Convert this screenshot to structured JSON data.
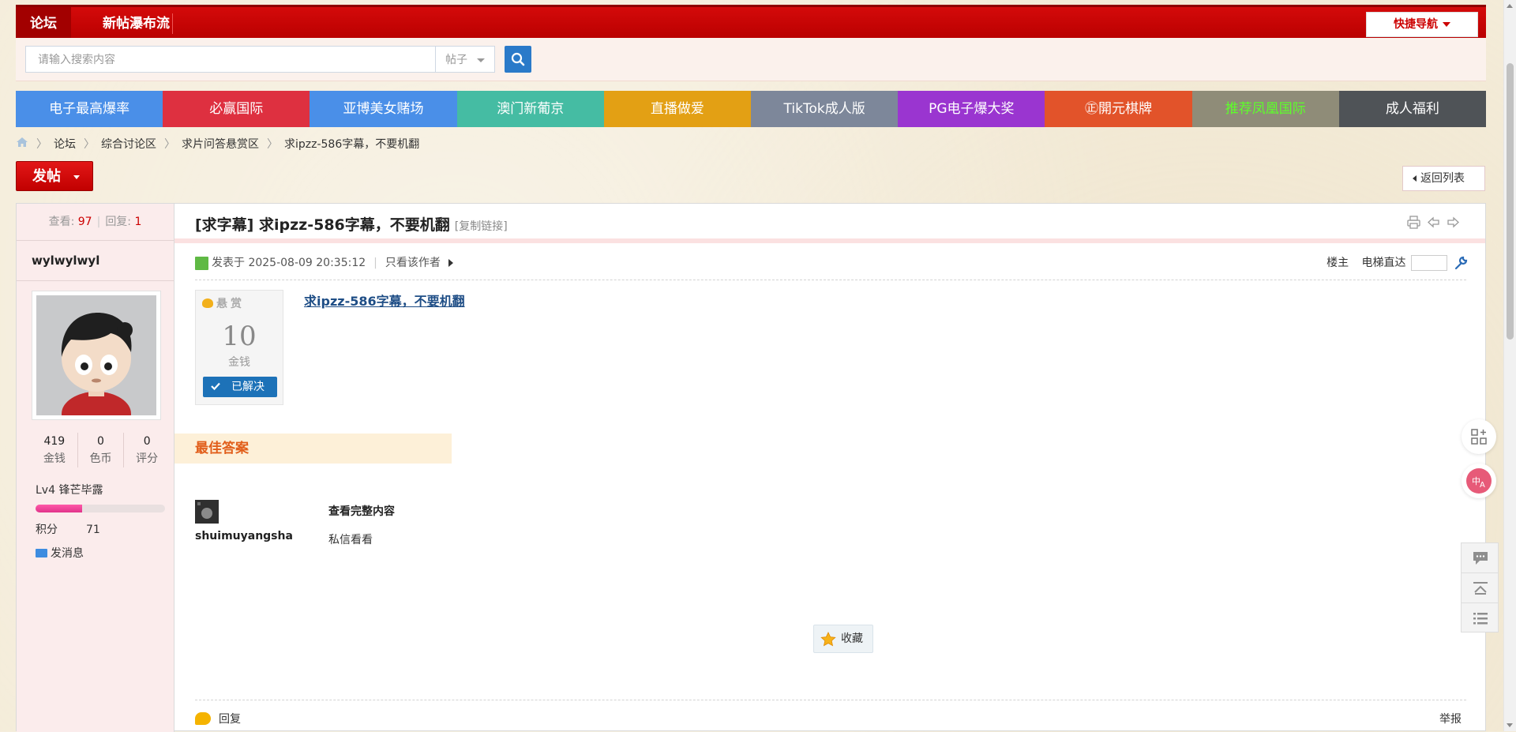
{
  "topnav": {
    "items": [
      {
        "label": "论坛"
      },
      {
        "label": "新帖瀑布流"
      }
    ],
    "quick_nav": "快捷导航"
  },
  "search": {
    "placeholder": "请输入搜索内容",
    "type": "帖子"
  },
  "ads": [
    {
      "label": "电子最高爆率",
      "bg": "#4a8fe8",
      "color": "#ffffff"
    },
    {
      "label": "必赢国际",
      "bg": "#de3040",
      "color": "#ffffff"
    },
    {
      "label": "亚博美女赌场",
      "bg": "#4a8fe8",
      "color": "#ffffff"
    },
    {
      "label": "澳门新葡京",
      "bg": "#45bca3",
      "color": "#ffffff"
    },
    {
      "label": "直播做爱",
      "bg": "#e3a014",
      "color": "#ffffff"
    },
    {
      "label": "TikTok成人版",
      "bg": "#7d879a",
      "color": "#ffffff"
    },
    {
      "label": "PG电子爆大奖",
      "bg": "#9a35d0",
      "color": "#ffffff"
    },
    {
      "label": "㊣開元棋牌",
      "bg": "#e2532a",
      "color": "#ffffff"
    },
    {
      "label": "推荐凤凰国际",
      "bg": "#8f8c78",
      "color": "#5dff2a"
    },
    {
      "label": "成人福利",
      "bg": "#4f5357",
      "color": "#ffffff"
    }
  ],
  "breadcrumb": [
    "论坛",
    "综合讨论区",
    "求片问答悬赏区",
    "求ipzz-586字幕，不要机翻"
  ],
  "buttons": {
    "post": "发帖",
    "back_to_list": "返回列表"
  },
  "author": {
    "views_label": "查看:",
    "views": "97",
    "replies_label": "回复:",
    "replies": "1",
    "username": "wylwylwyl",
    "credits": [
      {
        "value": "419",
        "label": "金钱"
      },
      {
        "value": "0",
        "label": "色币"
      },
      {
        "value": "0",
        "label": "评分"
      }
    ],
    "level": "Lv4 锋芒毕露",
    "level_progress": 0.36,
    "points_label": "积分",
    "points": "71",
    "send_message": "发消息"
  },
  "thread": {
    "title": "[求字幕] 求ipzz-586字幕，不要机翻",
    "copy_link": "[复制链接]",
    "posted_at": "发表于 2025-08-09 20:35:12",
    "only_author": "只看该作者",
    "floor_owner": "楼主",
    "elevator": "电梯直达"
  },
  "reward": {
    "header": "悬赏",
    "amount": "10",
    "unit": "金钱",
    "status": "已解决",
    "link_text": "求ipzz-586字幕，不要机翻"
  },
  "best_answer": {
    "label": "最佳答案",
    "username": "shuimuyangsha",
    "heading": "查看完整内容",
    "body": "私信看看"
  },
  "actions": {
    "favorite": "收藏",
    "reply": "回复",
    "report": "举报"
  },
  "icons": [
    "home-icon",
    "search-icon",
    "print-icon",
    "prev-thread-icon",
    "next-thread-icon",
    "wrench-icon",
    "grid-add-icon",
    "translate-icon",
    "comment-icon",
    "back-to-top-icon",
    "list-icon",
    "star-icon"
  ]
}
